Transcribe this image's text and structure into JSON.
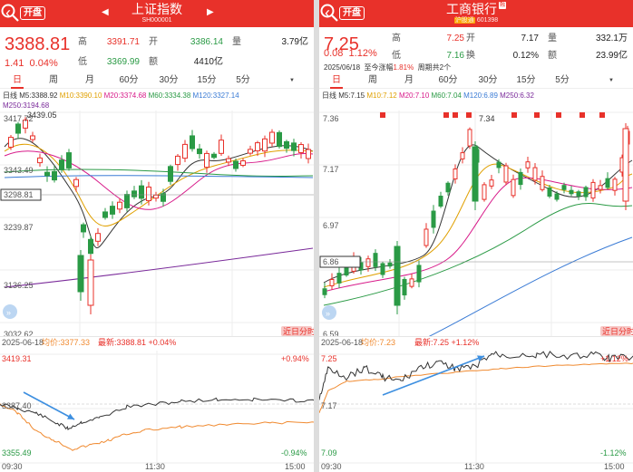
{
  "left": {
    "header": {
      "badge": "开盘",
      "title": "上证指数",
      "code": "SH000001"
    },
    "quote": {
      "price": "3388.81",
      "change": "1.41",
      "change_pct": "0.04%",
      "high_label": "高",
      "high": "3391.71",
      "low_label": "低",
      "low": "3369.99",
      "open_label": "开",
      "open": "3386.14",
      "volume_label": "量",
      "volume": "3.79亿",
      "amount_label": "额",
      "amount": "4410亿"
    },
    "tabs": [
      "日",
      "周",
      "月",
      "60分",
      "30分",
      "15分",
      "5分"
    ],
    "ma_row1": [
      {
        "text": "日线 M5:3388.92",
        "color": "#333333"
      },
      {
        "text": "M10:3390.10",
        "color": "#e0a000"
      },
      {
        "text": "M20:3374.68",
        "color": "#d81b8a"
      },
      {
        "text": "M60:3334.38",
        "color": "#2a9a45"
      },
      {
        "text": "M120:3327.14",
        "color": "#3a7bd5"
      }
    ],
    "ma_row2": [
      {
        "text": "M250:3194.68",
        "color": "#7a2a9a"
      }
    ],
    "kline": {
      "y_labels": [
        "3417.72",
        "3343.49",
        "3298.81",
        "3239.87",
        "3136.25",
        "3032.62"
      ],
      "peak_label": "3439.05",
      "corner_label": "近日分时"
    },
    "intraday": {
      "date": "2025-06-18",
      "avg_label": "均价:3377.33",
      "last_label": "最新:3388.81",
      "pct_label": "+0.04%",
      "y_top": "3419.31",
      "y_mid": "3387.40",
      "y_bottom": "3355.49",
      "pct_top": "+0.94%",
      "pct_bottom": "-0.94%",
      "times": [
        "09:30",
        "11:30",
        "15:00"
      ]
    }
  },
  "right": {
    "header": {
      "badge": "开盘",
      "title": "工商银行",
      "title_badge": "融",
      "tag": "沪股通",
      "code": "601398"
    },
    "quote": {
      "price": "7.25",
      "change": "0.08",
      "change_pct": "1.12%",
      "high_label": "高",
      "high": "7.25",
      "low_label": "低",
      "low": "7.16",
      "open_label": "开",
      "open": "7.17",
      "turnover_label": "换",
      "turnover": "0.12%",
      "volume_label": "量",
      "volume": "332.1万",
      "amount_label": "额",
      "amount": "23.99亿"
    },
    "note": {
      "date": "2025/06/18",
      "text1": "至今涨幅",
      "pct": "1.81%",
      "text2": "周期共2个"
    },
    "tabs": [
      "日",
      "周",
      "月",
      "60分",
      "30分",
      "15分",
      "5分"
    ],
    "ma_row1": [
      {
        "text": "日线 M5:7.15",
        "color": "#333333"
      },
      {
        "text": "M10:7.12",
        "color": "#e0a000"
      },
      {
        "text": "M20:7.10",
        "color": "#d81b8a"
      },
      {
        "text": "M60:7.04",
        "color": "#2a9a45"
      },
      {
        "text": "M120:6.89",
        "color": "#3a7bd5"
      },
      {
        "text": "M250:6.32",
        "color": "#7a2a9a"
      }
    ],
    "kline": {
      "y_labels": [
        "7.36",
        "7.17",
        "6.97",
        "6.86",
        "6.59"
      ],
      "peak_label": "7.34",
      "corner_label": "近日分时"
    },
    "intraday": {
      "date": "2025-06-18",
      "avg_label": "均价:7.23",
      "last_label": "最新:7.25",
      "pct_label": "+1.12%",
      "y_top": "7.25",
      "y_mid": "7.17",
      "y_bottom": "7.09",
      "pct_top": "+1.12%",
      "pct_bottom": "-1.12%",
      "times": [
        "09:30",
        "11:30",
        "15:00"
      ]
    }
  },
  "colors": {
    "up": "#e8312a",
    "down": "#2a9a45",
    "header": "#e8312a",
    "price_line": "#333333",
    "avg_line": "#f08a30",
    "arrow": "#3d8fe0"
  }
}
